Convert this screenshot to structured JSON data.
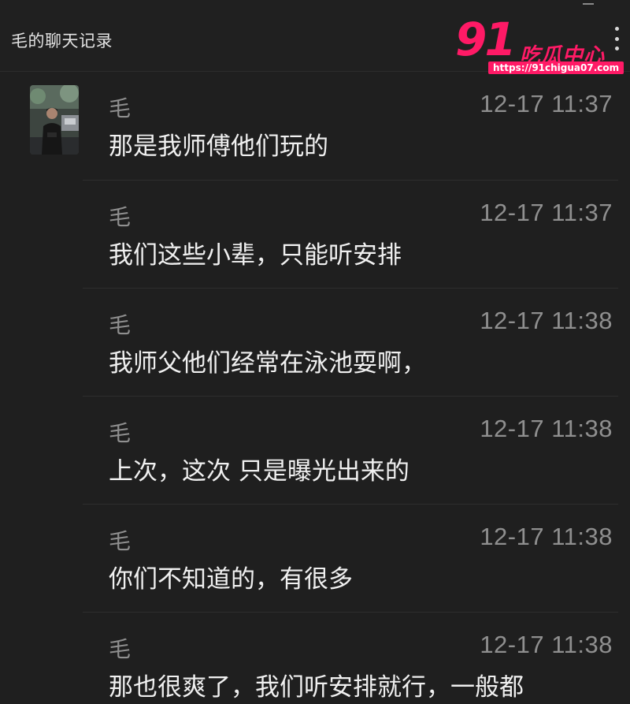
{
  "window": {
    "title": "毛的聊天记录"
  },
  "watermark": {
    "logo_number": "91",
    "logo_text": "吃瓜中心",
    "url": "https://91chigua07.com"
  },
  "messages": [
    {
      "sender": "毛",
      "time": "12-17 11:37",
      "text": "那是我师傅他们玩的"
    },
    {
      "sender": "毛",
      "time": "12-17 11:37",
      "text": "我们这些小辈，只能听安排"
    },
    {
      "sender": "毛",
      "time": "12-17 11:38",
      "text": "我师父他们经常在泳池耍啊，"
    },
    {
      "sender": "毛",
      "time": "12-17 11:38",
      "text": "上次，这次 只是曝光出来的"
    },
    {
      "sender": "毛",
      "time": "12-17 11:38",
      "text": "你们不知道的，有很多"
    },
    {
      "sender": "毛",
      "time": "12-17 11:38",
      "text": "那也很爽了，我们听安排就行，一般都"
    }
  ]
}
